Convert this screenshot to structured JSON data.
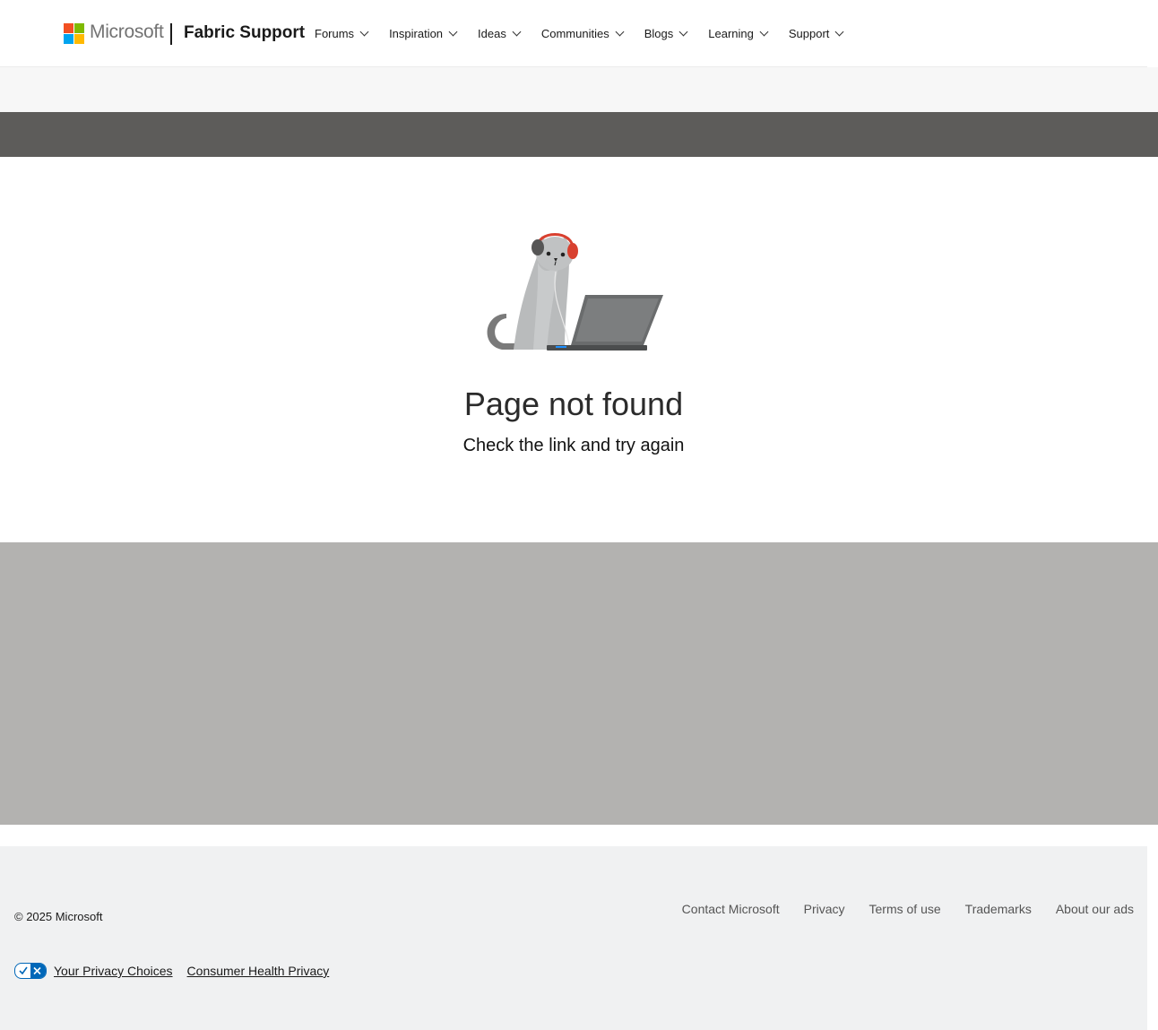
{
  "header": {
    "brand": "Microsoft",
    "site_title": "Fabric Support",
    "nav": [
      {
        "label": "Forums"
      },
      {
        "label": "Inspiration"
      },
      {
        "label": "Ideas"
      },
      {
        "label": "Communities"
      },
      {
        "label": "Blogs"
      },
      {
        "label": "Learning"
      },
      {
        "label": "Support"
      }
    ]
  },
  "main": {
    "title": "Page not found",
    "subtitle": "Check the link and try again"
  },
  "footer": {
    "copyright": "© 2025 Microsoft",
    "links": [
      "Contact Microsoft",
      "Privacy",
      "Terms of use",
      "Trademarks",
      "About our ads"
    ],
    "privacy_choices": "Your Privacy Choices",
    "consumer_health": "Consumer Health Privacy"
  },
  "colors": {
    "dark_band": "#5d5c5a",
    "gray_band": "#b3b2b0",
    "footer_bg": "#f0f1f2",
    "accent": "#0067b8"
  }
}
